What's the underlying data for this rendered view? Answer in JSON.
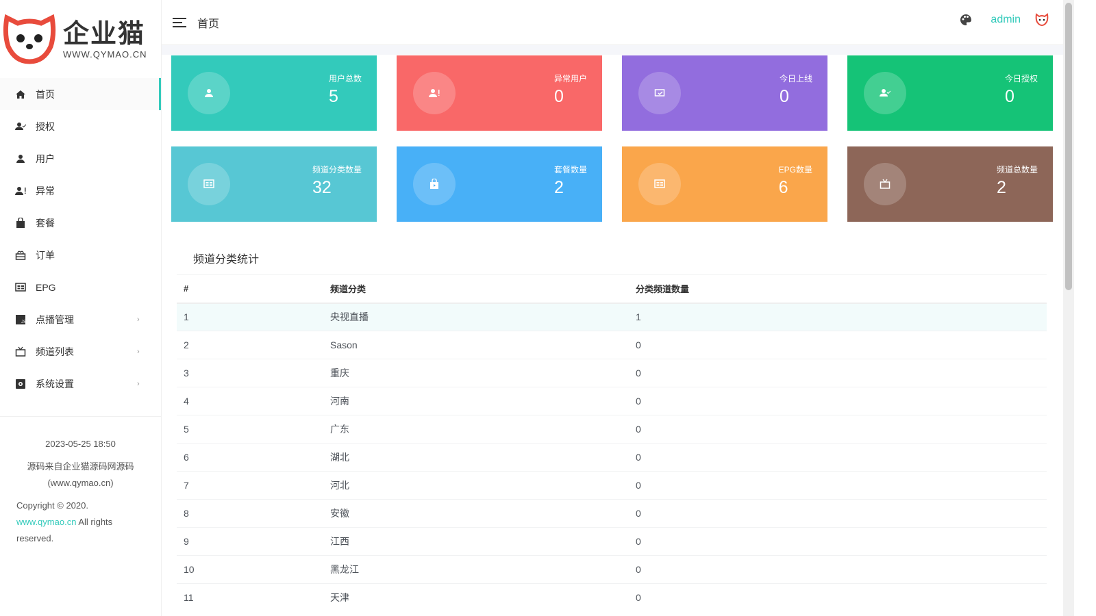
{
  "logo": {
    "cn": "企业猫",
    "en": "WWW.QYMAO.CN"
  },
  "sidebar": {
    "items": [
      {
        "label": "首页",
        "icon": "home-icon",
        "active": true
      },
      {
        "label": "授权",
        "icon": "user-check-icon"
      },
      {
        "label": "用户",
        "icon": "user-icon"
      },
      {
        "label": "异常",
        "icon": "user-alert-icon"
      },
      {
        "label": "套餐",
        "icon": "shopping-bag-icon"
      },
      {
        "label": "订单",
        "icon": "gift-icon"
      },
      {
        "label": "EPG",
        "icon": "newspaper-icon"
      },
      {
        "label": "点播管理",
        "icon": "js-icon",
        "arrow": "›"
      },
      {
        "label": "频道列表",
        "icon": "tv-icon",
        "arrow": "›"
      },
      {
        "label": "系统设置",
        "icon": "settings-icon",
        "arrow": "›"
      }
    ]
  },
  "footer": {
    "datetime": "2023-05-25 18:50",
    "source": "源码来自企业猫源码网源码",
    "source_url": "(www.qymao.cn)",
    "copyright": "Copyright © 2020.",
    "link": "www.qymao.cn",
    "rights": " All rights reserved."
  },
  "header": {
    "title": "首页",
    "user": "admin"
  },
  "cards": [
    {
      "label": "用户总数",
      "value": "5",
      "color": "#33cabb",
      "icon": "user"
    },
    {
      "label": "异常用户",
      "value": "0",
      "color": "#f96868",
      "icon": "user-alert"
    },
    {
      "label": "今日上线",
      "value": "0",
      "color": "#926dde",
      "icon": "online"
    },
    {
      "label": "今日授权",
      "value": "0",
      "color": "#15c377",
      "icon": "user-check"
    },
    {
      "label": "频道分类数量",
      "value": "32",
      "color": "#57c7d4",
      "icon": "newspaper"
    },
    {
      "label": "套餐数量",
      "value": "2",
      "color": "#48b0f7",
      "icon": "bag"
    },
    {
      "label": "EPG数量",
      "value": "6",
      "color": "#faa64b",
      "icon": "newspaper"
    },
    {
      "label": "频道总数量",
      "value": "2",
      "color": "#8d6658",
      "icon": "tv"
    }
  ],
  "panel": {
    "title": "频道分类统计",
    "columns": [
      "#",
      "频道分类",
      "分类频道数量"
    ],
    "rows": [
      [
        "1",
        "央视直播",
        "1"
      ],
      [
        "2",
        "Sason",
        "0"
      ],
      [
        "3",
        "重庆",
        "0"
      ],
      [
        "4",
        "河南",
        "0"
      ],
      [
        "5",
        "广东",
        "0"
      ],
      [
        "6",
        "湖北",
        "0"
      ],
      [
        "7",
        "河北",
        "0"
      ],
      [
        "8",
        "安徽",
        "0"
      ],
      [
        "9",
        "江西",
        "0"
      ],
      [
        "10",
        "黑龙江",
        "0"
      ],
      [
        "11",
        "天津",
        "0"
      ]
    ]
  }
}
